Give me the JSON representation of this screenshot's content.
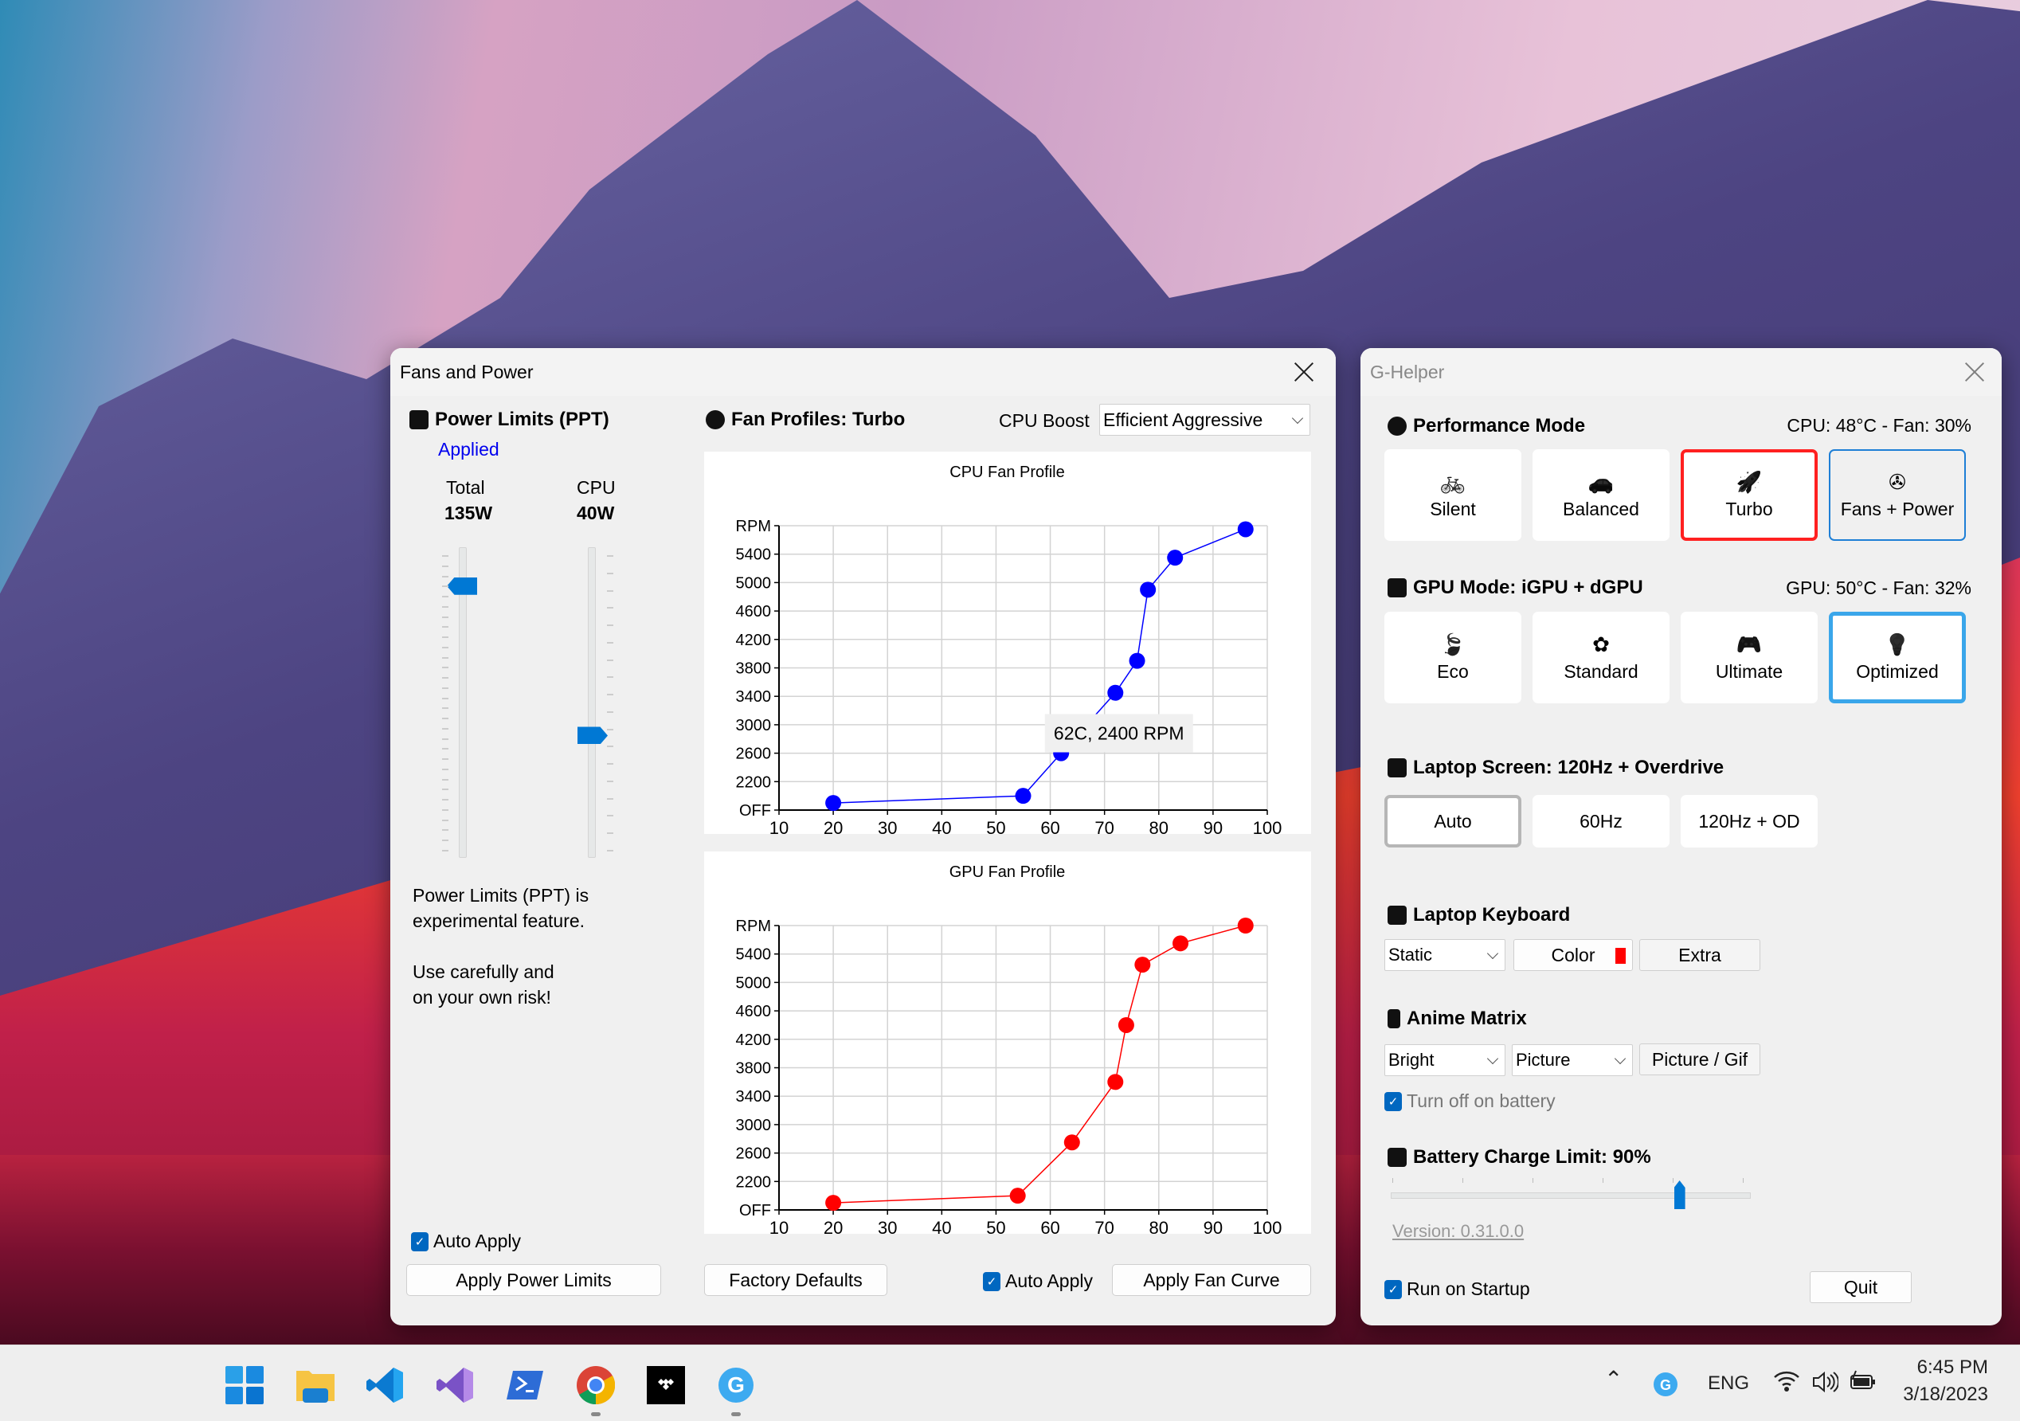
{
  "fans_window": {
    "title": "Fans and Power",
    "power": {
      "heading": "Power Limits (PPT)",
      "status": "Applied",
      "total_label": "Total",
      "total_value": "135W",
      "total_fraction": 0.9,
      "cpu_label": "CPU",
      "cpu_value": "40W",
      "cpu_fraction": 0.39,
      "warning_line1": "Power Limits (PPT) is",
      "warning_line2": "experimental feature.",
      "warning_line3": "Use carefully and",
      "warning_line4": "on your own risk!",
      "auto_apply_label": "Auto Apply",
      "auto_apply_checked": true,
      "apply_button": "Apply Power Limits"
    },
    "fans": {
      "heading": "Fan Profiles: Turbo",
      "cpu_boost_label": "CPU Boost",
      "cpu_boost_value": "Efficient Aggressive",
      "factory_defaults_button": "Factory Defaults",
      "auto_apply_label": "Auto Apply",
      "auto_apply_checked": true,
      "apply_button": "Apply Fan Curve"
    }
  },
  "chart_data": [
    {
      "type": "line",
      "title": "CPU Fan Profile",
      "xlabel": "",
      "ylabel": "RPM",
      "x": [
        20,
        55,
        62,
        72,
        76,
        78,
        83,
        96
      ],
      "series": [
        {
          "name": "CPU",
          "color": "#0000ff",
          "values": [
            1900,
            2000,
            2600,
            3450,
            3900,
            4900,
            5350,
            5750
          ]
        }
      ],
      "xlim": [
        10,
        100
      ],
      "ylim": [
        1800,
        5800
      ],
      "xticks": [
        "10",
        "20",
        "30",
        "40",
        "50",
        "60",
        "70",
        "80",
        "90",
        "100"
      ],
      "yticks": [
        "OFF",
        "2200",
        "2600",
        "3000",
        "3400",
        "3800",
        "4200",
        "4600",
        "5000",
        "5400",
        "RPM"
      ],
      "tooltip": "62C, 2400 RPM",
      "grid": true
    },
    {
      "type": "line",
      "title": "GPU Fan Profile",
      "xlabel": "",
      "ylabel": "RPM",
      "x": [
        20,
        54,
        64,
        72,
        74,
        77,
        84,
        96
      ],
      "series": [
        {
          "name": "GPU",
          "color": "#ff0000",
          "values": [
            1900,
            2000,
            2750,
            3600,
            4400,
            5250,
            5550,
            5800
          ]
        }
      ],
      "xlim": [
        10,
        100
      ],
      "ylim": [
        1800,
        5800
      ],
      "xticks": [
        "10",
        "20",
        "30",
        "40",
        "50",
        "60",
        "70",
        "80",
        "90",
        "100"
      ],
      "yticks": [
        "OFF",
        "2200",
        "2600",
        "3000",
        "3400",
        "3800",
        "4200",
        "4600",
        "5000",
        "5400",
        "RPM"
      ],
      "grid": true
    }
  ],
  "ghelper": {
    "title": "G-Helper",
    "performance": {
      "heading": "Performance Mode",
      "status": "CPU: 48°C -  Fan: 30%",
      "modes": [
        {
          "label": "Silent",
          "icon": "bicycle-icon",
          "glyph": "🚲"
        },
        {
          "label": "Balanced",
          "icon": "car-icon",
          "glyph": "🚗"
        },
        {
          "label": "Turbo",
          "icon": "rocket-icon",
          "glyph": "🚀"
        },
        {
          "label": "Fans + Power",
          "icon": "fan-icon",
          "glyph": "✇"
        }
      ],
      "selected": "Turbo"
    },
    "gpu": {
      "heading": "GPU Mode: iGPU + dGPU",
      "status": "GPU: 50°C -  Fan: 32%",
      "modes": [
        {
          "label": "Eco",
          "icon": "leaf-icon",
          "glyph": "🍃"
        },
        {
          "label": "Standard",
          "icon": "flower-icon",
          "glyph": "✿"
        },
        {
          "label": "Ultimate",
          "icon": "gamepad-icon",
          "glyph": "🎮"
        },
        {
          "label": "Optimized",
          "icon": "bulb-gear-icon",
          "glyph": "💡"
        }
      ],
      "selected": "Optimized"
    },
    "screen": {
      "heading": "Laptop Screen: 120Hz + Overdrive",
      "modes": [
        "Auto",
        "60Hz",
        "120Hz + OD"
      ],
      "selected": "Auto"
    },
    "keyboard": {
      "heading": "Laptop Keyboard",
      "mode_value": "Static",
      "color_button": "Color",
      "color": "#ff0000",
      "extra_button": "Extra"
    },
    "anime": {
      "heading": "Anime Matrix",
      "brightness_value": "Bright",
      "mode_value": "Picture",
      "picture_button": "Picture / Gif",
      "turn_off_label": "Turn off on battery",
      "turn_off_checked": true
    },
    "battery": {
      "heading": "Battery Charge Limit: 90%",
      "limit_fraction": 0.8
    },
    "version": "Version: 0.31.0.0",
    "run_on_startup_label": "Run on Startup",
    "run_on_startup_checked": true,
    "quit_button": "Quit"
  },
  "taskbar": {
    "apps": [
      "start-icon",
      "file-explorer-icon",
      "vscode-icon",
      "visual-studio-icon",
      "powershell-icon",
      "chrome-icon",
      "tidal-icon",
      "g-helper-icon"
    ],
    "language": "ENG",
    "time": "6:45 PM",
    "date": "3/18/2023"
  }
}
